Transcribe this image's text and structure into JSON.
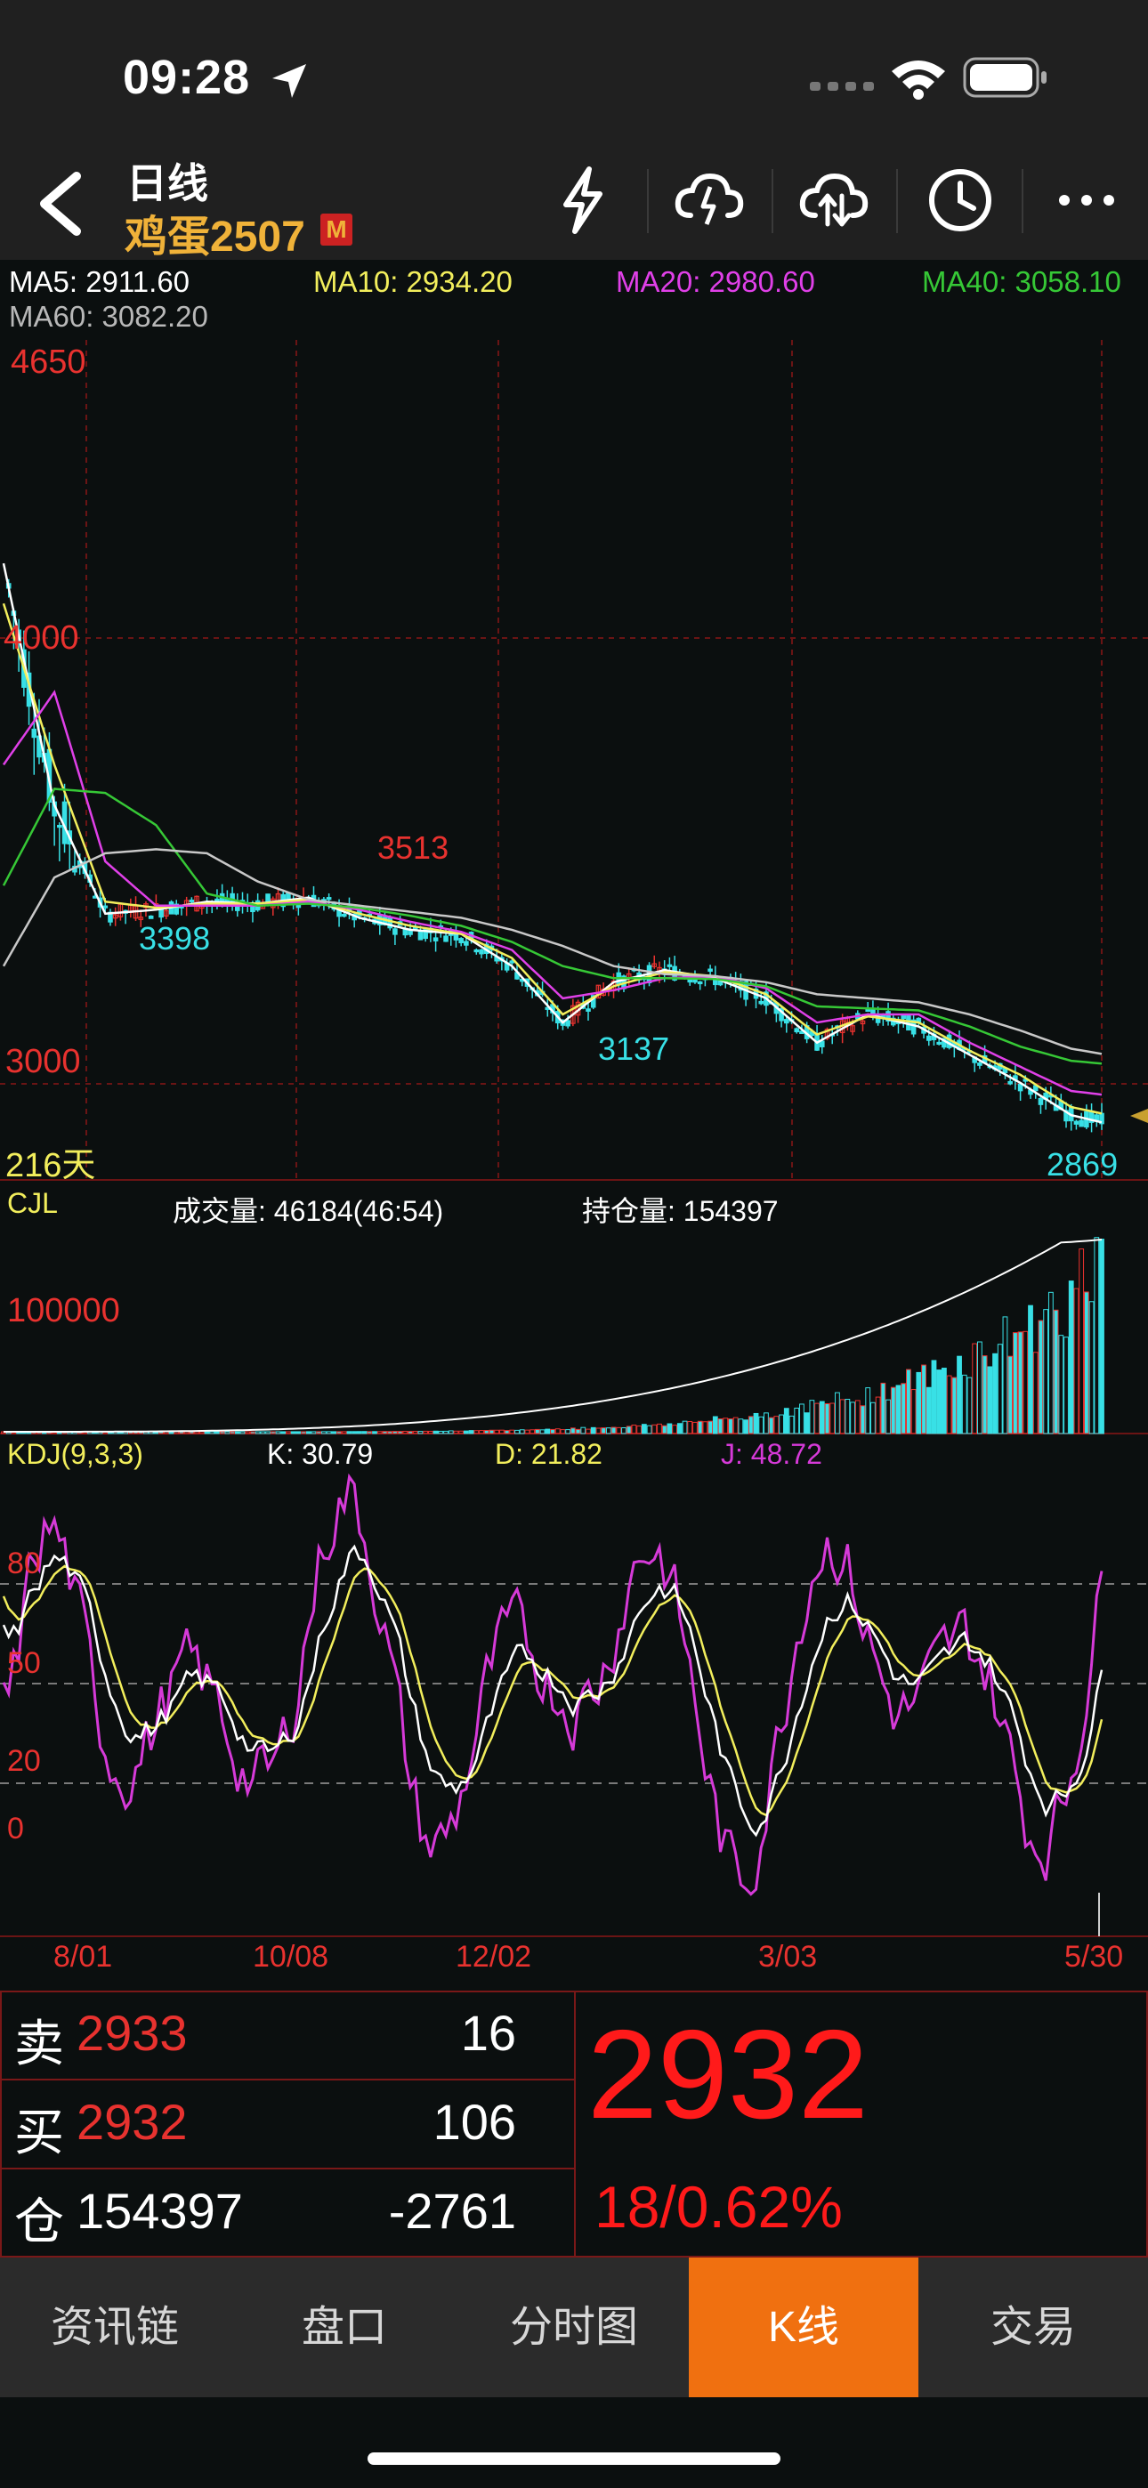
{
  "status_bar": {
    "time": "09:28"
  },
  "header": {
    "back_label": "<",
    "title": "日线",
    "symbol": "鸡蛋2507",
    "badge": "M"
  },
  "ma": {
    "ma5": "MA5: 2911.60",
    "ma10": "MA10: 2934.20",
    "ma20": "MA20: 2980.60",
    "ma40": "MA40: 3058.10",
    "ma60": "MA60: 3082.20"
  },
  "colors": {
    "up": "#e8322f",
    "down": "#38e0e6",
    "ma5": "#ffffff",
    "ma10": "#f2ee5c",
    "ma20": "#e040e8",
    "ma40": "#36c836",
    "ma60": "#c8c8c8",
    "accent": "#f07010"
  },
  "kline": {
    "y_top": "4650",
    "y_mid": "4000",
    "y_low": "3000",
    "days": "216天",
    "peak_labels": [
      "3398",
      "3513",
      "3137",
      "2869"
    ]
  },
  "volume": {
    "title": "CJL",
    "volume_label": "成交量: 46184(46:54)",
    "oi_label": "持仓量: 154397",
    "scale": "100000"
  },
  "kdj": {
    "title": "KDJ(9,3,3)",
    "k": "K: 30.79",
    "d": "D: 21.82",
    "j": "J: 48.72",
    "levels": [
      "80",
      "50",
      "20",
      "0"
    ]
  },
  "dates": [
    "8/01",
    "10/08",
    "12/02",
    "3/03",
    "5/30"
  ],
  "quote": {
    "sell_label": "卖",
    "sell_price": "2933",
    "sell_qty": "16",
    "buy_label": "买",
    "buy_price": "2932",
    "buy_qty": "106",
    "oi_label": "仓",
    "oi_value": "154397",
    "oi_change": "-2761",
    "last_price": "2932",
    "change": "18/0.62%"
  },
  "tabs": [
    "资讯链",
    "盘口",
    "分时图",
    "K线",
    "交易"
  ],
  "chart_data": [
    {
      "type": "line",
      "title": "",
      "x": [
        0,
        10,
        20,
        30,
        40,
        50,
        60,
        70,
        80,
        90,
        100,
        110,
        120,
        130,
        140,
        150,
        160,
        170,
        180,
        190,
        200,
        210,
        216
      ],
      "series": [
        {
          "name": "MA5",
          "values": [
            4300,
            3700,
            3430,
            3440,
            3460,
            3455,
            3470,
            3420,
            3390,
            3380,
            3300,
            3160,
            3260,
            3290,
            3270,
            3220,
            3110,
            3180,
            3150,
            3080,
            3010,
            2930,
            2912
          ]
        },
        {
          "name": "MA10",
          "values": [
            4200,
            3800,
            3460,
            3445,
            3455,
            3455,
            3465,
            3430,
            3400,
            3380,
            3320,
            3180,
            3250,
            3285,
            3275,
            3230,
            3130,
            3175,
            3160,
            3090,
            3030,
            2950,
            2934
          ]
        },
        {
          "name": "MA20",
          "values": [
            3800,
            3980,
            3560,
            3450,
            3450,
            3450,
            3460,
            3440,
            3410,
            3385,
            3340,
            3220,
            3240,
            3270,
            3275,
            3245,
            3160,
            3180,
            3180,
            3110,
            3050,
            2990,
            2981
          ]
        },
        {
          "name": "MA40",
          "values": [
            3500,
            3740,
            3730,
            3650,
            3480,
            3450,
            3455,
            3445,
            3425,
            3400,
            3360,
            3300,
            3270,
            3270,
            3268,
            3250,
            3200,
            3195,
            3190,
            3150,
            3100,
            3065,
            3058
          ]
        },
        {
          "name": "MA60",
          "values": [
            3300,
            3520,
            3580,
            3590,
            3580,
            3510,
            3465,
            3450,
            3435,
            3420,
            3390,
            3350,
            3300,
            3280,
            3275,
            3260,
            3230,
            3220,
            3210,
            3180,
            3140,
            3095,
            3082
          ]
        }
      ],
      "ylim": [
        2800,
        4700
      ]
    }
  ]
}
